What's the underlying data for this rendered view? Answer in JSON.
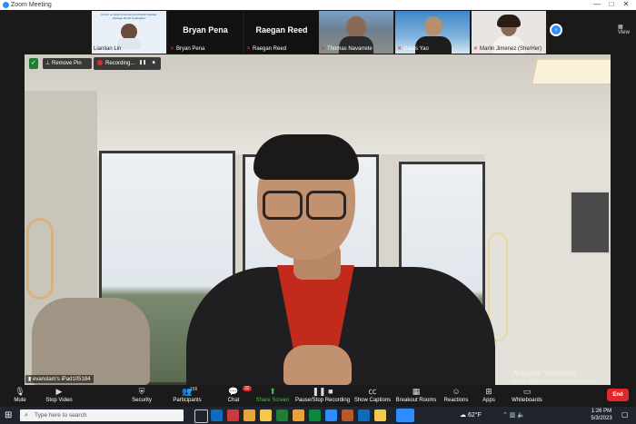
{
  "window": {
    "title": "Zoom Meeting",
    "controls": [
      "—",
      "□",
      "✕"
    ]
  },
  "strip": {
    "tiles": [
      {
        "name": "Lianlian Lin",
        "slide_line1": "Forum on Asian American and Pacific Islander",
        "slide_line2": "Heritage Month Celebration"
      },
      {
        "name": "Bryan Pena",
        "big": "Bryan Pena"
      },
      {
        "name": "Raegan Reed",
        "big": "Raegan Reed"
      },
      {
        "name": "Thomas Navarrete"
      },
      {
        "name": "Gates Yao"
      },
      {
        "name": "Marlin Jimenez (She/Her)"
      }
    ],
    "view_label": "View"
  },
  "overlay": {
    "remove_pin": "Remove Pin",
    "recording": "Recording...",
    "speaker": "evanslam's iPad105184"
  },
  "watermark": {
    "line1": "Activate Windows",
    "line2": "Go to Settings to activate Windows."
  },
  "toolbar": {
    "mute": "Mute",
    "stop_video": "Stop Video",
    "security": "Security",
    "participants": "Participants",
    "participants_count": "156",
    "chat": "Chat",
    "chat_badge": "32",
    "share_screen": "Share Screen",
    "record": "Pause/Stop Recording",
    "captions": "Show Captions",
    "breakout": "Breakout Rooms",
    "reactions": "Reactions",
    "apps": "Apps",
    "whiteboards": "Whiteboards",
    "end": "End"
  },
  "taskbar": {
    "search_placeholder": "Type here to search",
    "weather": "62°F",
    "time": "1:26 PM",
    "date": "5/3/2023",
    "app_colors": [
      "#0f6cbd",
      "#cc3a3a",
      "#e8a33a",
      "#f2c94c",
      "#1e7e34",
      "#e9a23b",
      "#0a8a3a",
      "#2d8cff",
      "#b8572a",
      "#0f6cbd",
      "#f2c94c",
      "#2d8cff"
    ]
  }
}
